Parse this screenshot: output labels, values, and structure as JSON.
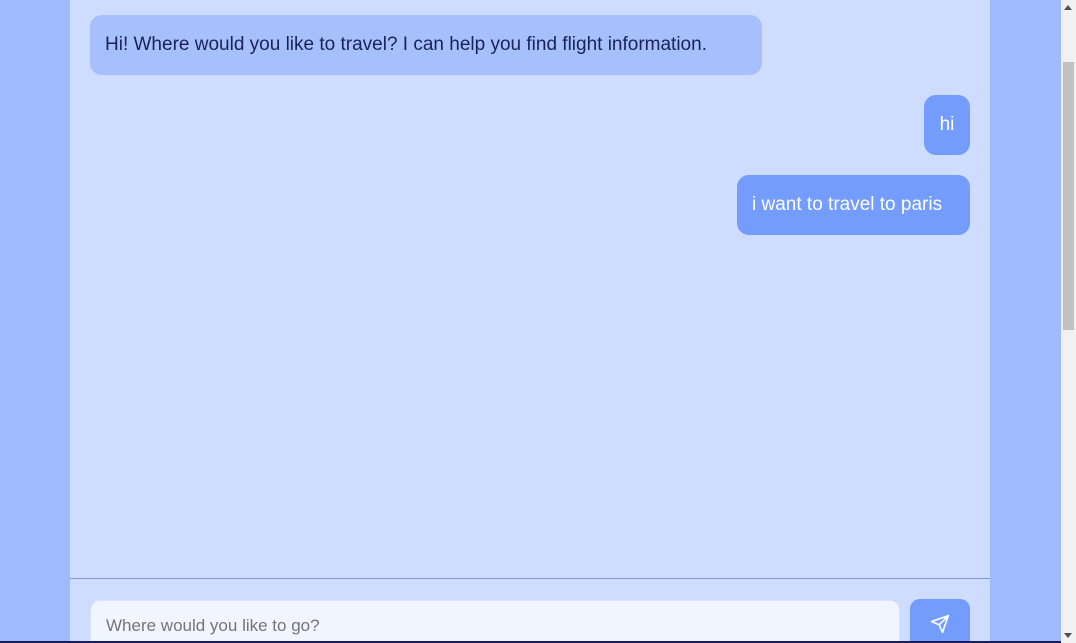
{
  "chat": {
    "messages": [
      {
        "sender": "bot",
        "text": "Hi! Where would you like to travel? I can help you find flight information."
      },
      {
        "sender": "user",
        "text": "hi"
      },
      {
        "sender": "user",
        "text": "i want to travel to paris"
      }
    ]
  },
  "composer": {
    "placeholder": "Where would you like to go?",
    "value": "",
    "send_icon": "send-icon"
  },
  "colors": {
    "page_bg": "#9fbafd",
    "panel_bg": "#cddcff",
    "bot_bubble": "#a6c0fd",
    "user_bubble": "#739cfc",
    "input_bg": "#f1f5ff"
  }
}
